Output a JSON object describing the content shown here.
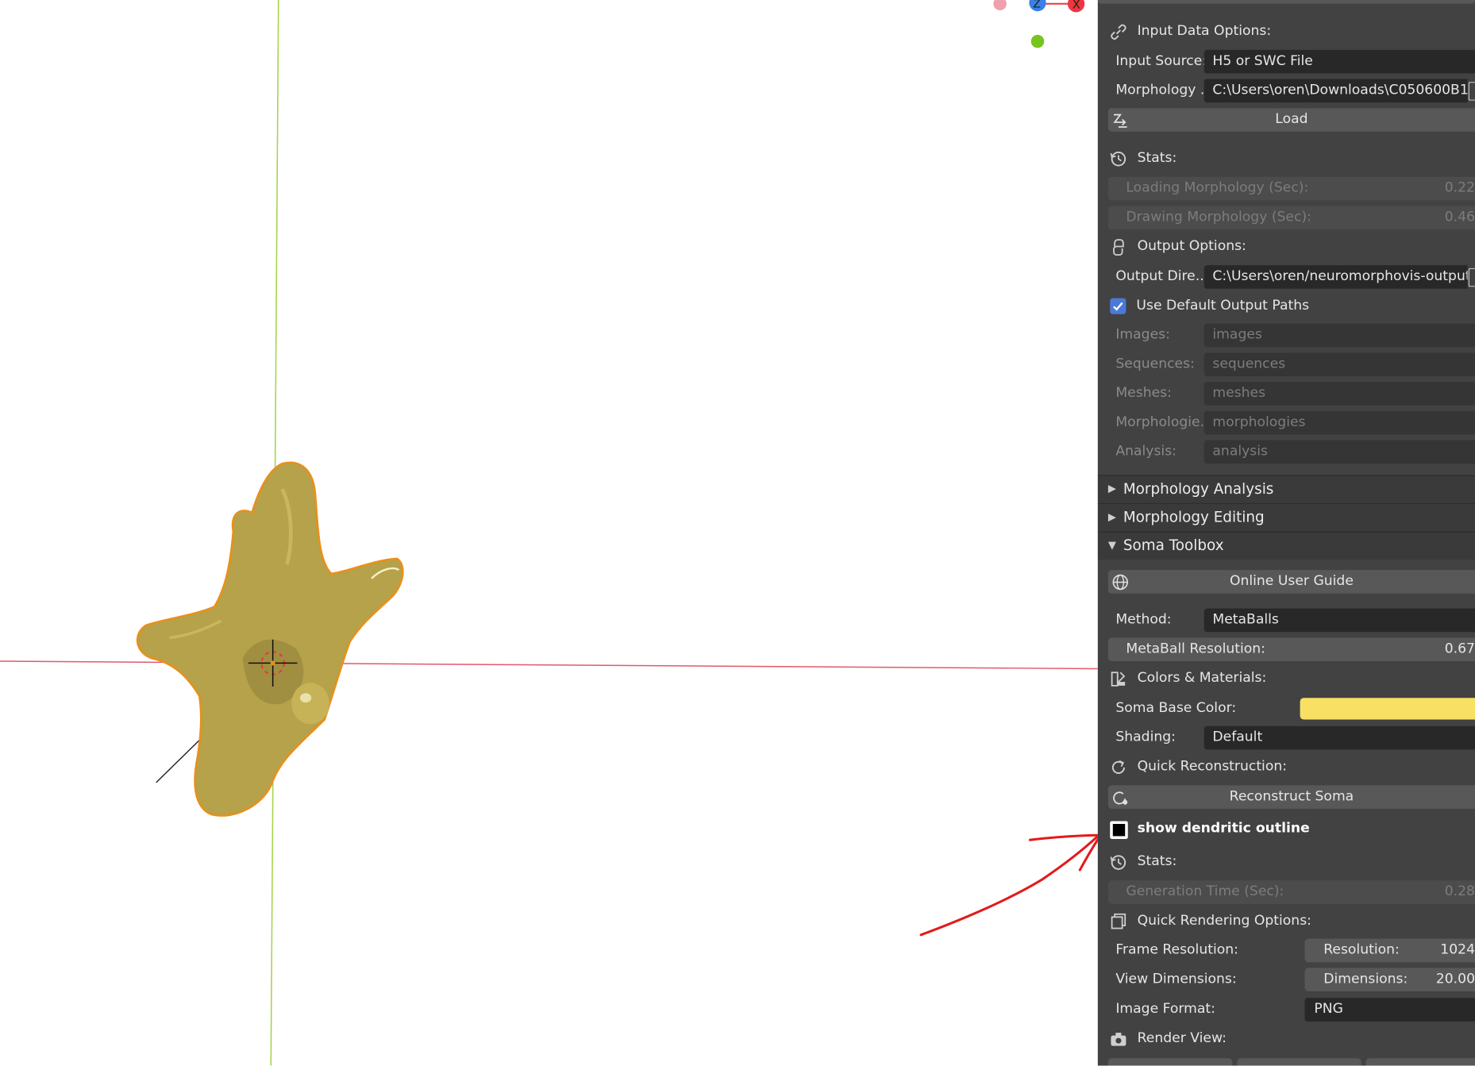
{
  "input_data": {
    "title": "Input Data Options:",
    "input_source_label": "Input Source:",
    "input_source_value": "H5 or SWC File",
    "morphology_label": "Morphology ..",
    "morphology_value": "C:\\Users\\oren\\Downloads\\C050600B1...",
    "load_label": "Load"
  },
  "stats1": {
    "title": "Stats:",
    "loading_label": "Loading Morphology (Sec):",
    "loading_value": "0.22",
    "drawing_label": "Drawing Morphology (Sec):",
    "drawing_value": "0.46"
  },
  "output": {
    "title": "Output Options:",
    "dir_label": "Output Dire..",
    "dir_value": "C:\\Users\\oren/neuromorphovis-output",
    "use_default_label": "Use Default Output Paths",
    "use_default_checked": true,
    "paths": [
      {
        "label": "Images:",
        "value": "images"
      },
      {
        "label": "Sequences:",
        "value": "sequences"
      },
      {
        "label": "Meshes:",
        "value": "meshes"
      },
      {
        "label": "Morphologie..",
        "value": "morphologies"
      },
      {
        "label": "Analysis:",
        "value": "analysis"
      }
    ]
  },
  "sections": {
    "morphology_analysis": "Morphology Analysis",
    "morphology_editing": "Morphology Editing",
    "soma_toolbox": "Soma Toolbox"
  },
  "soma": {
    "online_guide": "Online User Guide",
    "method_label": "Method:",
    "method_value": "MetaBalls",
    "resolution_label": "MetaBall Resolution:",
    "resolution_value": "0.67",
    "colors_title": "Colors & Materials:",
    "base_color_label": "Soma Base Color:",
    "base_color": "#f7e064",
    "shading_label": "Shading:",
    "shading_value": "Default",
    "quick_recon_title": "Quick Reconstruction:",
    "reconstruct_label": "Reconstruct Soma",
    "dendritic_outline_label": "show dendritic outline",
    "stats_title": "Stats:",
    "gen_time_label": "Generation Time (Sec):",
    "gen_time_value": "0.28"
  },
  "rendering": {
    "title": "Quick Rendering Options:",
    "frame_label": "Frame Resolution:",
    "frame_field_label": "Resolution:",
    "frame_value": "1024",
    "view_label": "View Dimensions:",
    "view_field_label": "Dimensions:",
    "view_value": "20.00",
    "format_label": "Image Format:",
    "format_value": "PNG",
    "render_view_title": "Render View:"
  },
  "gizmo": {
    "z_label": "Z",
    "x_label": "X"
  },
  "colors": {
    "soma_fill": "#b5a24a",
    "soma_outline": "#e8901c",
    "x_axis": "#e05a6a",
    "y_axis": "#a6d34a",
    "annotation_arrow": "#e21b1b"
  }
}
